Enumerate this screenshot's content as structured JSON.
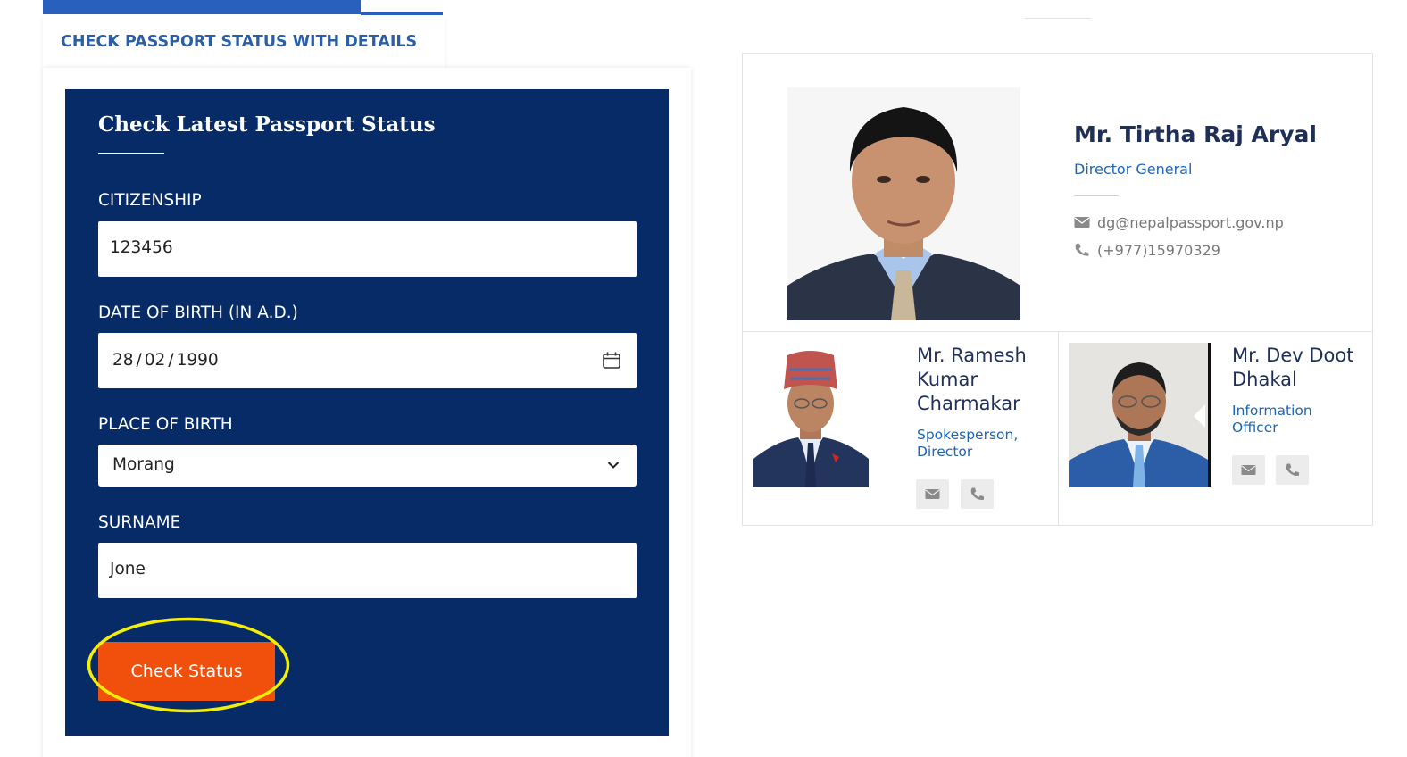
{
  "left_panel": {
    "tab_label": "CHECK PASSPORT STATUS WITH DETAILS",
    "form": {
      "title": "Check Latest Passport Status",
      "citizenship": {
        "label": "CITIZENSHIP",
        "value": "123456"
      },
      "date_of_birth": {
        "label": "DATE OF BIRTH (IN A.D.)",
        "day": "28",
        "month": "02",
        "year": "1990",
        "separator": "/"
      },
      "place_of_birth": {
        "label": "PLACE OF BIRTH",
        "selected": "Morang"
      },
      "surname": {
        "label": "SURNAME",
        "value": "Jone"
      },
      "submit_label": "Check Status"
    }
  },
  "officials": {
    "director_general": {
      "name": "Mr. Tirtha Raj Aryal",
      "role": "Director General",
      "email": "dg@nepalpassport.gov.np",
      "phone": "(+977)15970329"
    },
    "spokesperson": {
      "name": "Mr. Ramesh Kumar Charmakar",
      "role": "Spokesperson, Director"
    },
    "information_officer": {
      "name": "Mr. Dev Doot Dhakal",
      "role": "Information Officer"
    }
  },
  "colors": {
    "form_background": "#072b66",
    "button": "#f0500b",
    "accent_blue": "#1f65b6",
    "highlight": "#f2ee05"
  }
}
